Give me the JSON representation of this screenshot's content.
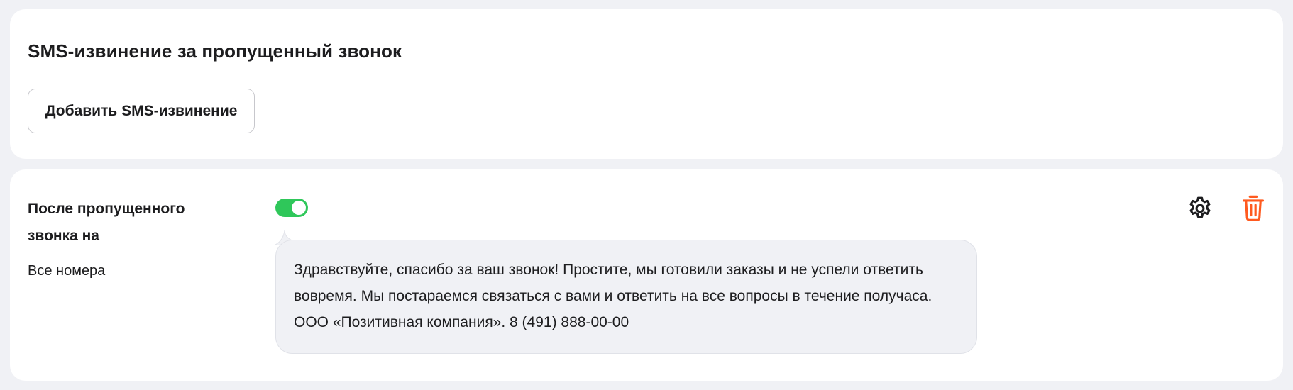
{
  "section": {
    "title": "SMS-извинение за пропущенный звонок",
    "add_button_label": "Добавить SMS-извинение"
  },
  "rule": {
    "title": "После пропущенного звонка на",
    "numbers_label": "Все номера",
    "enabled": true,
    "message": "Здравствуйте, спасибо за ваш звонок! Простите, мы готовили заказы и не успели ответить вовремя. Мы постараемся связаться с вами и ответить на все вопросы в течение получаса. ООО «Позитивная компания». 8 (491) 888-00-00",
    "settings_icon": "gear-icon",
    "delete_icon": "trash-icon"
  },
  "colors": {
    "background": "#f0f1f5",
    "card": "#ffffff",
    "toggle_on": "#2fc75a",
    "delete": "#ff5a1f",
    "bubble": "#f0f1f5"
  }
}
